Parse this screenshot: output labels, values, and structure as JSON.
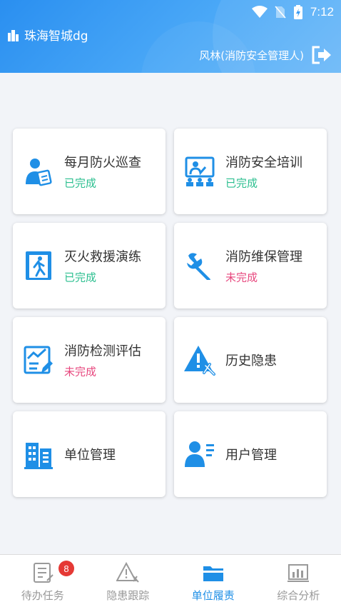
{
  "status_bar": {
    "time": "7:12"
  },
  "header": {
    "app_title": "珠海智城dg",
    "user_label": "风林(消防安全管理人)"
  },
  "cards": [
    {
      "title": "每月防火巡查",
      "status": "已完成",
      "icon": "patrol-person-icon"
    },
    {
      "title": "消防安全培训",
      "status": "已完成",
      "icon": "training-board-icon"
    },
    {
      "title": "灭火救援演练",
      "status": "已完成",
      "icon": "evacuation-door-icon"
    },
    {
      "title": "消防维保管理",
      "status": "未完成",
      "icon": "wrench-icon"
    },
    {
      "title": "消防检测评估",
      "status": "未完成",
      "icon": "assessment-chart-icon"
    },
    {
      "title": "历史隐患",
      "status": "",
      "icon": "warning-tools-icon"
    },
    {
      "title": "单位管理",
      "status": "",
      "icon": "building-icon"
    },
    {
      "title": "用户管理",
      "status": "",
      "icon": "user-card-icon"
    }
  ],
  "colors": {
    "done": "#2bbf8f",
    "undone": "#e7467d",
    "accent": "#1f8fe6"
  },
  "bottom_nav": {
    "items": [
      {
        "label": "待办任务",
        "badge": "8"
      },
      {
        "label": "隐患跟踪"
      },
      {
        "label": "单位履责",
        "active": true
      },
      {
        "label": "综合分析"
      }
    ]
  }
}
